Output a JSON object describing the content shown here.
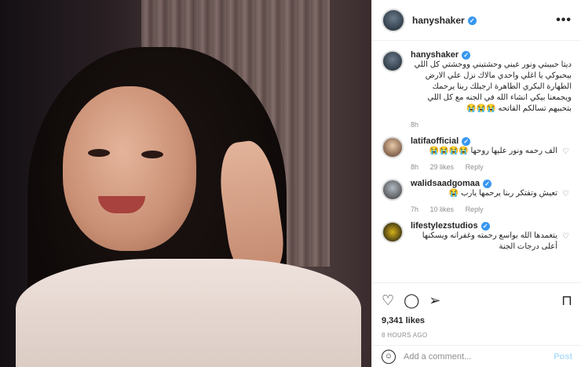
{
  "post": {
    "username": "hanyshaker",
    "more_label": "•••"
  },
  "caption": {
    "username": "hanyshaker",
    "text": "ديتا حبيبتي ونور عيني وحشتيني ووحشتي كل اللي بيحبوكي يا اغلي واحدي مالاك نزل علي الارض الطهارة البكري الطاهرة ارجيلك ربنا يرحمك ويجمعنا بيكي انشاء الله في الجنه مع كل اللي بتحبيهم تسالكم الفاتحه 😭😭😭",
    "time": "8h"
  },
  "comments": [
    {
      "username": "latifaofficial",
      "text": "الف رحمه ونور عليها روحها 😭😭😭😭",
      "time": "8h",
      "likes": "29 likes",
      "reply": "Reply"
    },
    {
      "username": "walidsaadgomaa",
      "text": "تعيش وتفتكر ربنا يرحمها يارب 😭",
      "time": "7h",
      "likes": "10 likes",
      "reply": "Reply"
    },
    {
      "username": "lifestylezstudios",
      "text": "يتغمدها الله بواسع رحمته وغفرانه ويسكنها أعلى درجات الجنة",
      "time": "",
      "likes": "",
      "reply": ""
    }
  ],
  "actions": {
    "likes": "9,341 likes",
    "time_ago": "8 HOURS AGO"
  },
  "add_comment": {
    "placeholder": "Add a comment...",
    "post_label": "Post"
  },
  "colors": {
    "verified": "#3897f0",
    "post_button": "#b2dffc"
  }
}
